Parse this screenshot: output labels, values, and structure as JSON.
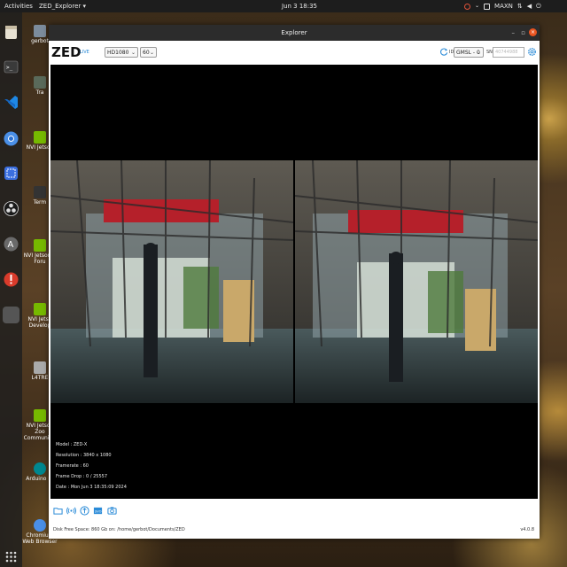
{
  "topbar": {
    "activities": "Activities",
    "app_menu": "ZED_Explorer ▾",
    "clock": "Jun 3 18:35",
    "power_mode": "MAXN"
  },
  "desktop_icons": [
    {
      "label": "gerbot"
    },
    {
      "label": "Tra"
    },
    {
      "label": "NVI Jetson"
    },
    {
      "label": "Term"
    },
    {
      "label": "NVI Jetson S Foru"
    },
    {
      "label": "NVI Jetso Develop"
    },
    {
      "label": "L4TRE"
    },
    {
      "label": "NVI Jetson Zoo Communit P"
    },
    {
      "label": "Arduino ID"
    },
    {
      "label": "Chromium Web Browser"
    }
  ],
  "window": {
    "title": "Explorer",
    "minimize": "–",
    "maximize": "▫",
    "close": "×"
  },
  "toolbar": {
    "logo": "ZED",
    "live": "LIVE",
    "resolution": "HD1080",
    "fps": "60",
    "id_label": "ID",
    "camera_select": "GMSL - 0",
    "sn_label": "SN",
    "sn_placeholder": "40744988"
  },
  "camera_info": {
    "model": "Model : ZED-X",
    "resolution": "Resolution : 3840 x 1080",
    "framerate": "Framerate : 60",
    "frame_drop": "Frame Drop : 0 / 25557",
    "date": "Date : Mon Jun 3 18:35:09 2024"
  },
  "footer": {
    "disk_space": "Disk Free Space: 860 Gb  on: /home/gerbot/Documents/ZED",
    "version": "v4.0.8"
  },
  "colors": {
    "accent": "#2a8bd8",
    "ubuntu_orange": "#e95420",
    "titlebar": "#2c2c2c"
  }
}
